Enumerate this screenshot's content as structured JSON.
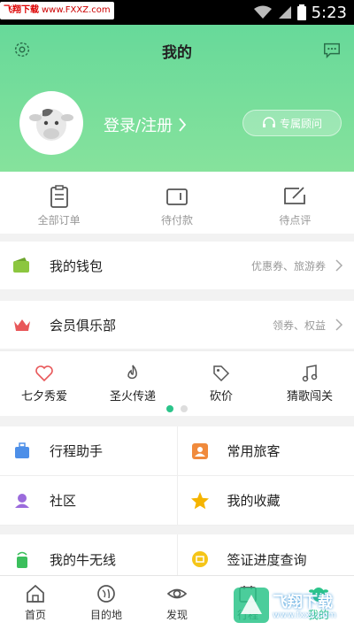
{
  "status_bar": {
    "time": "5:23",
    "watermark": "www.FXXZ.com",
    "watermark_brand": "飞翔下载"
  },
  "header": {
    "title": "我的",
    "login_text": "登录/注册",
    "advisor_label": "专属顾问"
  },
  "orders": [
    {
      "icon": "clipboard-icon",
      "label": "全部订单"
    },
    {
      "icon": "wallet-icon",
      "label": "待付款"
    },
    {
      "icon": "edit-comment-icon",
      "label": "待点评"
    }
  ],
  "wallet": {
    "label": "我的钱包",
    "sub": "优惠券、旅游券"
  },
  "club": {
    "label": "会员俱乐部",
    "sub": "领券、权益"
  },
  "features": [
    {
      "icon": "heart-icon",
      "label": "七夕秀爱"
    },
    {
      "icon": "fire-icon",
      "label": "圣火传递"
    },
    {
      "icon": "price-tag-icon",
      "label": "砍价"
    },
    {
      "icon": "music-note-icon",
      "label": "猜歌闯关"
    }
  ],
  "grid1": [
    {
      "icon": "luggage-icon",
      "label": "行程助手",
      "color": "#4d8fe8"
    },
    {
      "icon": "traveler-icon",
      "label": "常用旅客",
      "color": "#f08a3c"
    },
    {
      "icon": "community-icon",
      "label": "社区",
      "color": "#9b6bdc"
    },
    {
      "icon": "star-icon",
      "label": "我的收藏",
      "color": "#f5b400"
    }
  ],
  "grid2": [
    {
      "icon": "wifi-device-icon",
      "label": "我的牛无线",
      "color": "#3bbf5c"
    },
    {
      "icon": "visa-icon",
      "label": "签证进度查询",
      "color": "#f5c518"
    }
  ],
  "tabs": [
    {
      "icon": "home-icon",
      "label": "首页"
    },
    {
      "icon": "destination-icon",
      "label": "目的地"
    },
    {
      "icon": "eye-icon",
      "label": "发现"
    },
    {
      "icon": "calendar-icon",
      "label": "行程"
    },
    {
      "icon": "cow-icon",
      "label": "我的"
    }
  ],
  "bottom_watermark": {
    "brand": "飞翔下载",
    "url": "www.fxxz.com"
  },
  "colors": {
    "primary": "#2bc48a",
    "header_top": "#67d99a",
    "wallet_icon": "#8cc63f",
    "crown_icon": "#e8585a"
  }
}
